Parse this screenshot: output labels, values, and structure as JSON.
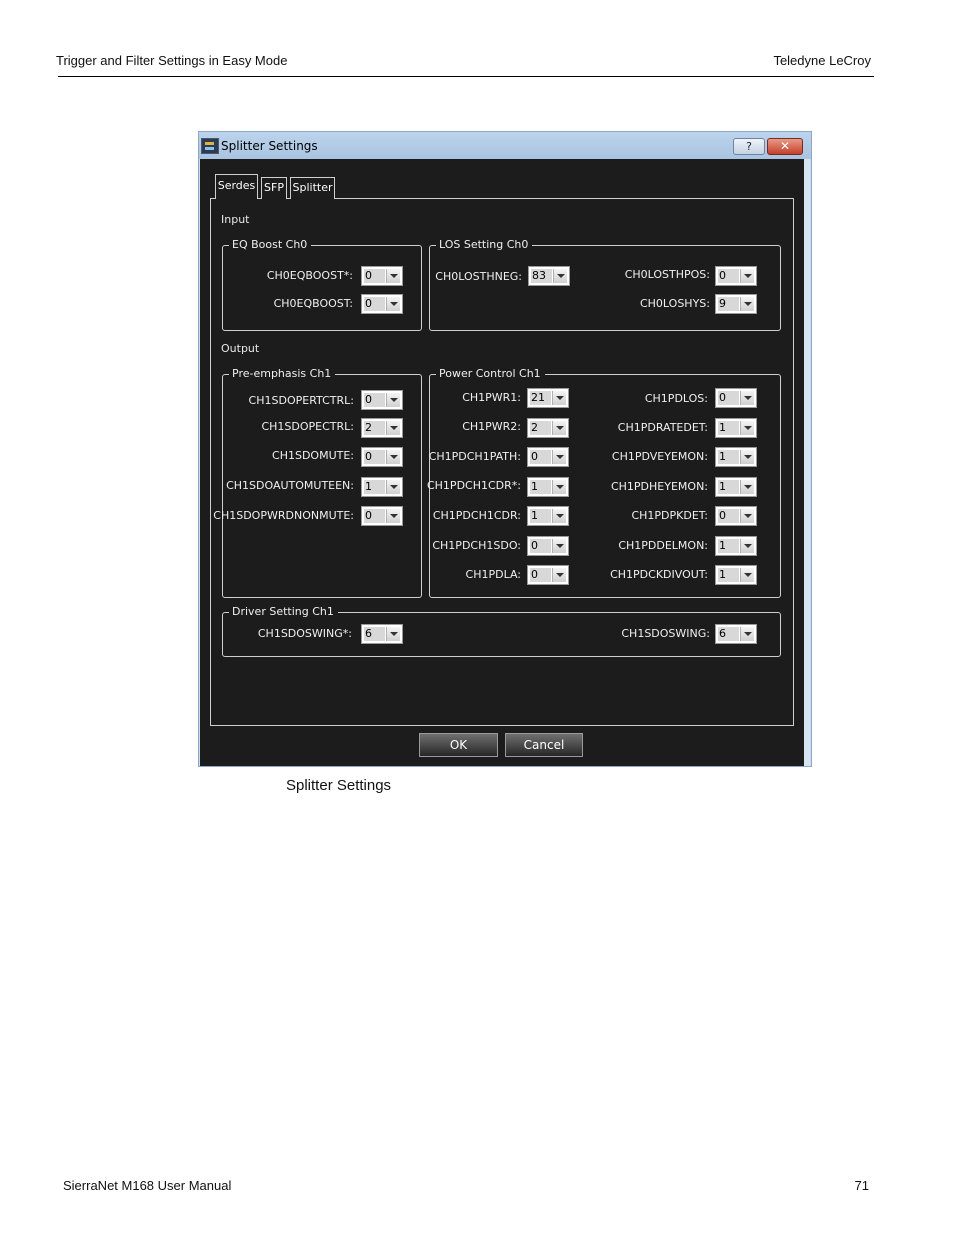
{
  "page": {
    "header_left": "Trigger and Filter Settings in Easy Mode",
    "header_right": "Teledyne  LeCroy",
    "caption": "Splitter Settings",
    "footer_left": "SierraNet M168 User Manual",
    "footer_right": "71"
  },
  "dialog": {
    "title": "Splitter Settings",
    "help_label": "?",
    "close_label": "✕",
    "tabs": [
      {
        "label": "Serdes",
        "active": true
      },
      {
        "label": "SFP",
        "active": false
      },
      {
        "label": "Splitter",
        "active": false
      }
    ],
    "input_label": "Input",
    "output_label": "Output",
    "eq_boost": {
      "title": "EQ Boost Ch0",
      "fields": [
        {
          "label": "CH0EQBOOST*:",
          "value": "0"
        },
        {
          "label": "CH0EQBOOST:",
          "value": "0"
        }
      ]
    },
    "los_setting": {
      "title": "LOS Setting Ch0",
      "fields": [
        {
          "label": "CH0LOSTHNEG:",
          "value": "83"
        },
        {
          "label": "CH0LOSTHPOS:",
          "value": "0"
        },
        {
          "label": "CH0LOSHYS:",
          "value": "9"
        }
      ]
    },
    "pre_emphasis": {
      "title": "Pre-emphasis Ch1",
      "fields": [
        {
          "label": "CH1SDOPERTCTRL:",
          "value": "0"
        },
        {
          "label": "CH1SDOPECTRL:",
          "value": "2"
        },
        {
          "label": "CH1SDOMUTE:",
          "value": "0"
        },
        {
          "label": "CH1SDOAUTOMUTEEN:",
          "value": "1"
        },
        {
          "label": "CH1SDOPWRDNONMUTE:",
          "value": "0"
        }
      ]
    },
    "power_control": {
      "title": "Power Control Ch1",
      "left_fields": [
        {
          "label": "CH1PWR1:",
          "value": "21"
        },
        {
          "label": "CH1PWR2:",
          "value": "2"
        },
        {
          "label": "CH1PDCH1PATH:",
          "value": "0"
        },
        {
          "label": "CH1PDCH1CDR*:",
          "value": "1"
        },
        {
          "label": "CH1PDCH1CDR:",
          "value": "1"
        },
        {
          "label": "CH1PDCH1SDO:",
          "value": "0"
        },
        {
          "label": "CH1PDLA:",
          "value": "0"
        }
      ],
      "right_fields": [
        {
          "label": "CH1PDLOS:",
          "value": "0"
        },
        {
          "label": "CH1PDRATEDET:",
          "value": "1"
        },
        {
          "label": "CH1PDVEYEMON:",
          "value": "1"
        },
        {
          "label": "CH1PDHEYEMON:",
          "value": "1"
        },
        {
          "label": "CH1PDPKDET:",
          "value": "0"
        },
        {
          "label": "CH1PDDELMON:",
          "value": "1"
        },
        {
          "label": "CH1PDCKDIVOUT:",
          "value": "1"
        }
      ]
    },
    "driver_setting": {
      "title": "Driver Setting Ch1",
      "fields": [
        {
          "label": "CH1SDOSWING*:",
          "value": "6"
        },
        {
          "label": "CH1SDOSWING:",
          "value": "6"
        }
      ]
    },
    "ok_label": "OK",
    "cancel_label": "Cancel"
  }
}
